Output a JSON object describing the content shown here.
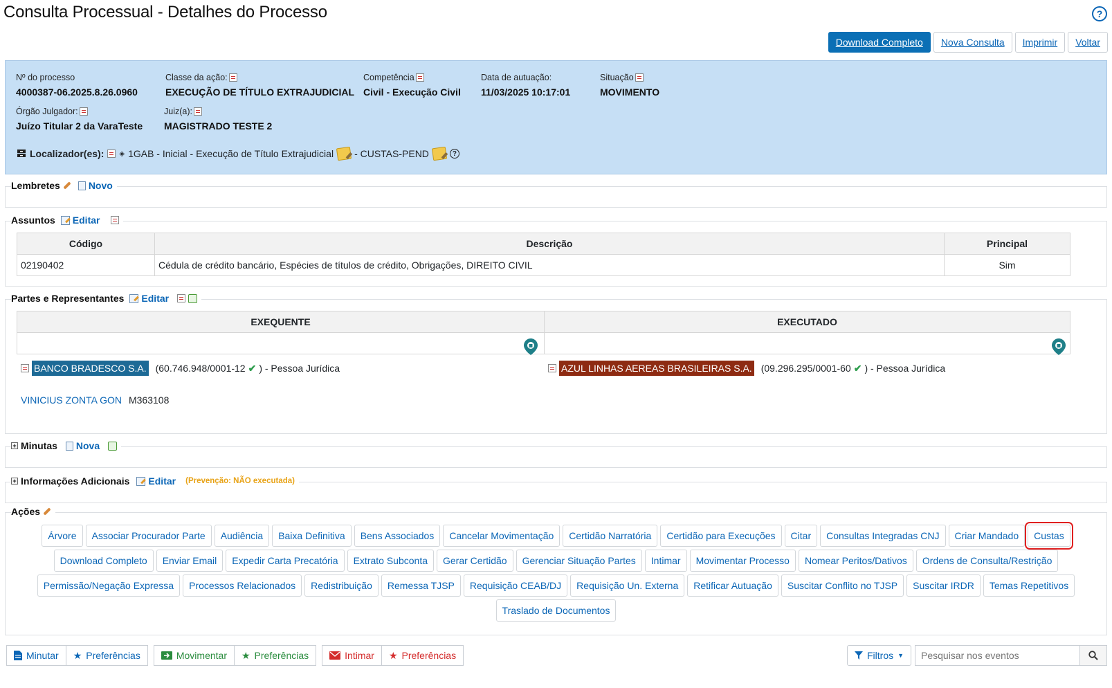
{
  "header": {
    "title": "Consulta Processual - Detalhes do Processo",
    "help": "?",
    "buttons": [
      "Download Completo",
      "Nova Consulta",
      "Imprimir",
      "Voltar"
    ]
  },
  "processo": {
    "numero_label": "Nº do processo",
    "numero": "4000387-06.2025.8.26.0960",
    "classe_label": "Classe da ação:",
    "classe": "EXECUÇÃO DE TÍTULO EXTRAJUDICIAL",
    "competencia_label": "Competência",
    "competencia": "Civil - Execução Civil",
    "data_label": "Data de autuação:",
    "data": "11/03/2025 10:17:01",
    "situacao_label": "Situação",
    "situacao": "MOVIMENTO",
    "orgao_label": "Órgão Julgador:",
    "orgao": "Juízo Titular 2 da VaraTeste",
    "juiz_label": "Juiz(a):",
    "juiz": "MAGISTRADO TESTE 2",
    "localizador_label": "Localizador(es):",
    "localizador_1": "1GAB - Inicial - Execução de Título Extrajudicial",
    "localizador_2": "- CUSTAS-PEND"
  },
  "lembretes": {
    "title": "Lembretes",
    "novo": "Novo"
  },
  "assuntos": {
    "title": "Assuntos",
    "editar": "Editar",
    "headers": [
      "Código",
      "Descrição",
      "Principal"
    ],
    "rows": [
      {
        "codigo": "02190402",
        "descricao": "Cédula de crédito bancário, Espécies de títulos de crédito, Obrigações, DIREITO CIVIL",
        "principal": "Sim"
      }
    ]
  },
  "partes": {
    "title": "Partes e Representantes",
    "editar": "Editar",
    "exequente_header": "EXEQUENTE",
    "executado_header": "EXECUTADO",
    "exequente_nome": "BANCO BRADESCO S.A.",
    "exequente_doc": "(60.746.948/0001-12",
    "exequente_tipo": ")  - Pessoa Jurídica",
    "advogado_nome": "VINICIUS ZONTA GON",
    "advogado_oab": "M363108",
    "executado_nome": "AZUL LINHAS AEREAS BRASILEIRAS S.A.",
    "executado_doc": "(09.296.295/0001-60",
    "executado_tipo": ")  - Pessoa Jurídica",
    "check": "✔",
    "colors": {
      "exequente": "#1d6a96",
      "executado": "#8e2b12"
    }
  },
  "minutas": {
    "title": "Minutas",
    "nova": "Nova"
  },
  "info_adicionais": {
    "title": "Informações Adicionais",
    "editar": "Editar",
    "prevencao": "(Prevenção:  NÃO executada)"
  },
  "acoes": {
    "title": "Ações",
    "row1": [
      "Árvore",
      "Associar Procurador Parte",
      "Audiência",
      "Baixa Definitiva",
      "Bens Associados",
      "Cancelar Movimentação",
      "Certidão Narratória",
      "Certidão para Execuções",
      "Citar",
      "Consultas Integradas CNJ",
      "Criar Mandado",
      "Custas"
    ],
    "row2": [
      "Download Completo",
      "Enviar Email",
      "Expedir Carta Precatória",
      "Extrato Subconta",
      "Gerar Certidão",
      "Gerenciar Situação Partes",
      "Intimar",
      "Movimentar Processo",
      "Nomear Peritos/Dativos",
      "Ordens de Consulta/Restrição"
    ],
    "row3": [
      "Permissão/Negação Expressa",
      "Processos Relacionados",
      "Redistribuição",
      "Remessa TJSP",
      "Requisição CEAB/DJ",
      "Requisição Un. Externa",
      "Retificar Autuação",
      "Suscitar Conflito no TJSP",
      "Suscitar IRDR",
      "Temas Repetitivos"
    ],
    "row4": [
      "Traslado de Documentos"
    ],
    "highlighted": "Custas"
  },
  "bottom": {
    "minutar": "Minutar",
    "preferencias": "Preferências",
    "movimentar": "Movimentar",
    "intimar": "Intimar",
    "filtros": "Filtros",
    "search_placeholder": "Pesquisar nos eventos"
  }
}
